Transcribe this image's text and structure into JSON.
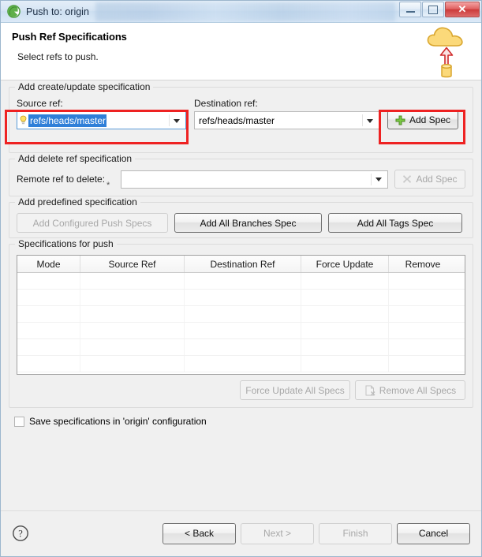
{
  "window": {
    "title": "Push to: origin",
    "app_icon": "egit-icon",
    "controls": {
      "minimize": "minimize-button",
      "maximize": "maximize-button",
      "close_label": "✕"
    }
  },
  "header": {
    "title": "Push Ref Specifications",
    "subtitle": "Select refs to push.",
    "icon": "push-to-cloud-icon"
  },
  "create_update_group": {
    "legend": "Add create/update specification",
    "source_label": "Source ref:",
    "source_value": "refs/heads/master",
    "destination_label": "Destination ref:",
    "destination_value": "refs/heads/master",
    "add_spec_label": "Add Spec"
  },
  "delete_group": {
    "legend": "Add delete ref specification",
    "remote_ref_label": "Remote ref to delete:",
    "remote_ref_value": "",
    "remote_ref_decoration": "*",
    "add_spec_label": "Add Spec"
  },
  "predefined_group": {
    "legend": "Add predefined specification",
    "buttons": [
      {
        "label": "Add Configured Push Specs",
        "enabled": false
      },
      {
        "label": "Add All Branches Spec",
        "enabled": true
      },
      {
        "label": "Add All Tags Spec",
        "enabled": true
      }
    ]
  },
  "specs_group": {
    "legend": "Specifications for push",
    "columns": [
      "Mode",
      "Source Ref",
      "Destination Ref",
      "Force Update",
      "Remove"
    ],
    "rows": [],
    "empty_row_count": 6,
    "force_update_all_label": "Force Update All Specs",
    "remove_all_label": "Remove All Specs"
  },
  "save_checkbox": {
    "label": "Save specifications in 'origin' configuration",
    "checked": false
  },
  "footer": {
    "help_icon": "help-icon",
    "buttons": [
      {
        "label": "< Back",
        "enabled": true
      },
      {
        "label": "Next >",
        "enabled": false
      },
      {
        "label": "Finish",
        "enabled": false
      },
      {
        "label": "Cancel",
        "enabled": true
      }
    ]
  },
  "annotations": {
    "highlight_color": "#ee2222",
    "boxes": [
      "source-ref-combo",
      "add-spec-button"
    ]
  },
  "colors": {
    "selection_blue": "#2f7fd8",
    "dialog_bg": "#f0f0f0",
    "banner_bg": "#ffffff",
    "annotation_red": "#ee2222"
  }
}
